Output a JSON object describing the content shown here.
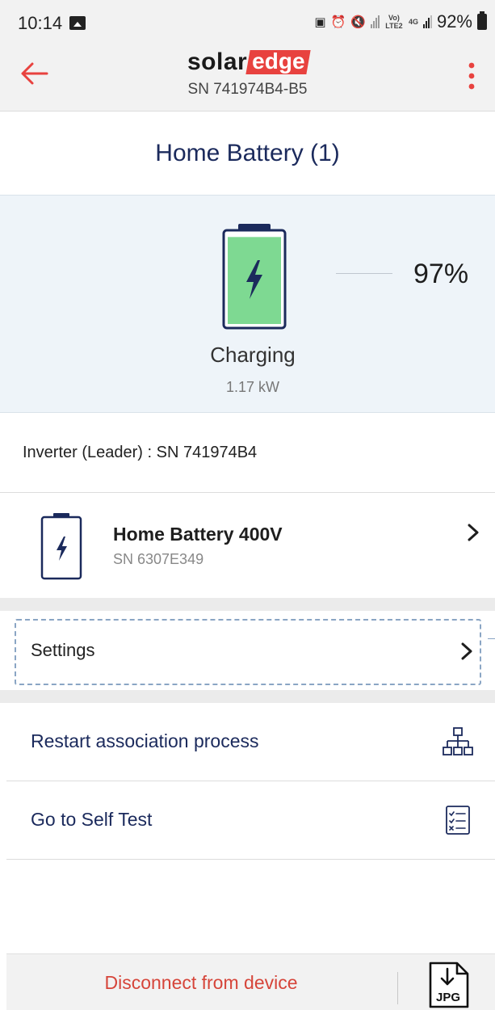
{
  "status_bar": {
    "time": "10:14",
    "network_small": "Vo) LTE2",
    "network_4g": "4G",
    "battery_pct": "92%"
  },
  "app_bar": {
    "logo_primary": "solar",
    "logo_accent": "edge",
    "serial": "SN 741974B4-B5"
  },
  "page": {
    "title": "Home Battery (1)"
  },
  "battery_status": {
    "level_pct": 97,
    "level_text": "97%",
    "state": "Charging",
    "power": "1.17 kW"
  },
  "inverter": {
    "label": "Inverter (Leader) : SN 741974B4"
  },
  "device": {
    "name": "Home Battery 400V",
    "serial": "SN 6307E349"
  },
  "settings": {
    "label": "Settings"
  },
  "actions": [
    {
      "label": "Restart association process",
      "icon": "network-hierarchy-icon"
    },
    {
      "label": "Go to Self Test",
      "icon": "checklist-icon"
    }
  ],
  "bottom_bar": {
    "disconnect_label": "Disconnect from device",
    "export_label": "JPG"
  },
  "colors": {
    "brand_red": "#e8423f",
    "navy": "#1b2a5c",
    "battery_fill": "#7ed992"
  }
}
